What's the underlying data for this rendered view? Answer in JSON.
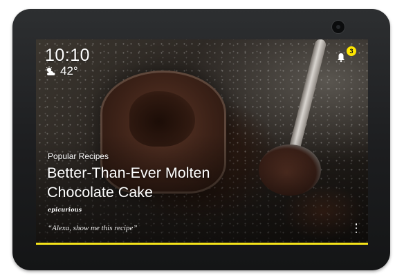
{
  "status": {
    "time": "10:10",
    "temperature": "42°",
    "weather_icon": "partly-cloudy-icon",
    "notification_count": "3",
    "notification_icon": "bell-icon"
  },
  "card": {
    "category": "Popular Recipes",
    "title": "Better-Than-Ever Molten Chocolate Cake",
    "source": "epicurious",
    "voice_prompt": "“Alexa, show me this recipe”",
    "more_icon": "vertical-dots-icon"
  },
  "colors": {
    "accent": "#f5e31a",
    "badge": "#ffe600",
    "device_frame": "#232425"
  }
}
